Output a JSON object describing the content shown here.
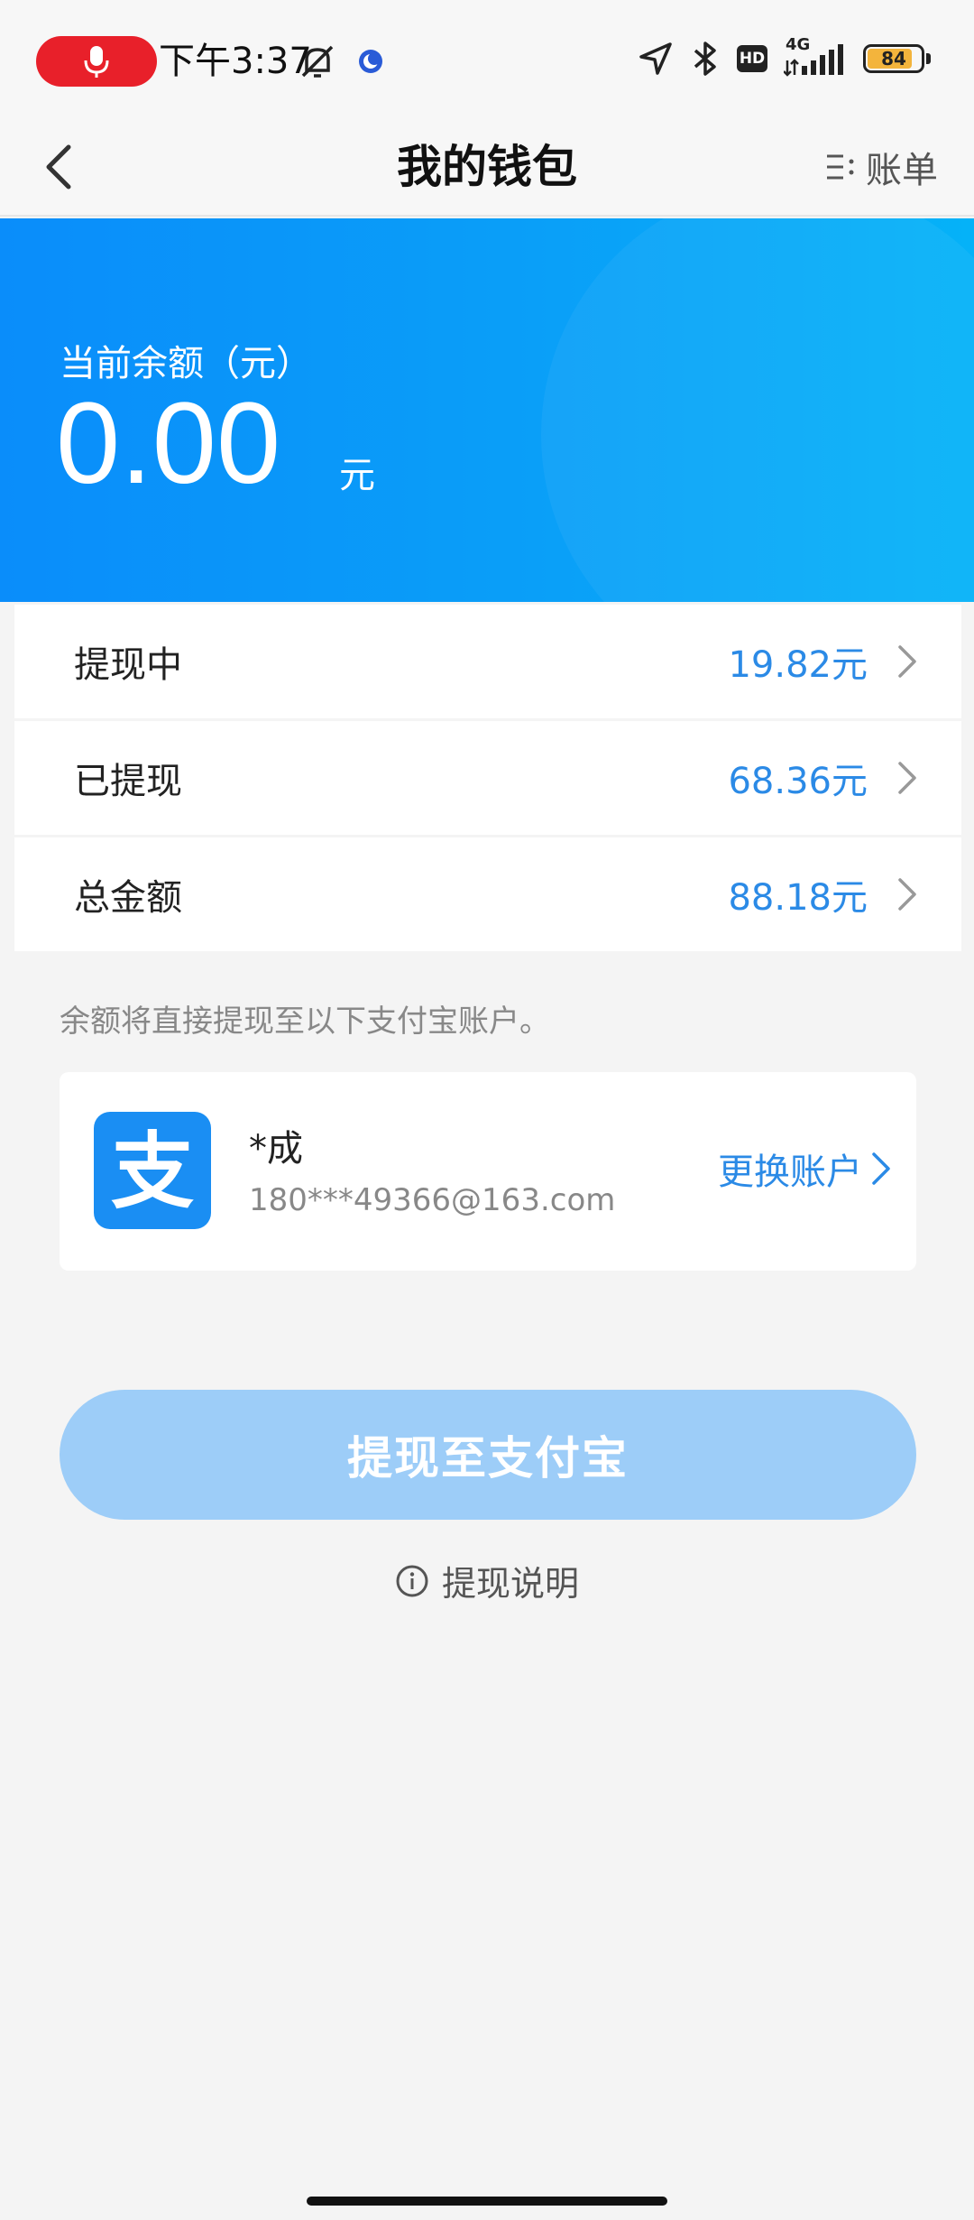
{
  "status_bar": {
    "time": "下午3:37",
    "network": "4G",
    "hd_label": "HD",
    "battery": "84",
    "battery_level": 0.84,
    "recording_color": "#e8202a"
  },
  "nav": {
    "title": "我的钱包",
    "bill_label": "账单",
    "back_icon": "chevron-left-icon",
    "bill_icon": "list-icon"
  },
  "balance": {
    "label": "当前余额（元）",
    "amount": "0.00",
    "unit": "元",
    "gradient_start": "#0a8dfa",
    "gradient_end": "#05b2f8"
  },
  "rows": [
    {
      "label": "提现中",
      "value": "19.82元"
    },
    {
      "label": "已提现",
      "value": "68.36元"
    },
    {
      "label": "总金额",
      "value": "88.18元"
    }
  ],
  "note": "余额将直接提现至以下支付宝账户。",
  "account": {
    "logo_icon": "alipay-icon",
    "logo_char": "支",
    "name": "*成",
    "email": "180***49366@163.com",
    "change_label": "更换账户"
  },
  "withdraw_button": "提现至支付宝",
  "info_link": "提现说明",
  "accent_color": "#2b8ae6"
}
